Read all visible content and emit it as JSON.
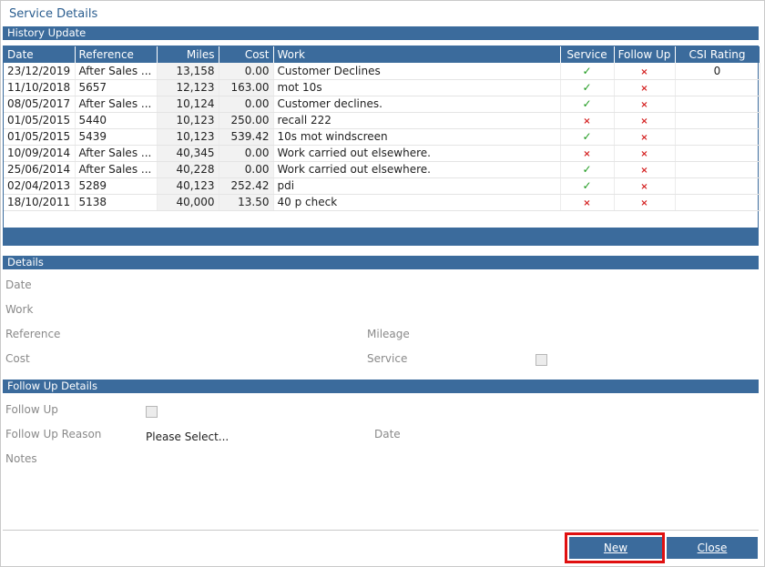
{
  "window": {
    "title": "Service Details"
  },
  "history": {
    "header": "History Update",
    "columns": {
      "date": "Date",
      "reference": "Reference",
      "miles": "Miles",
      "cost": "Cost",
      "work": "Work",
      "service": "Service",
      "follow_up": "Follow Up",
      "csi_rating": "CSI Rating"
    },
    "rows": [
      {
        "date": "23/12/2019",
        "reference": "After Sales ...",
        "miles": "13,158",
        "cost": "0.00",
        "work": "Customer Declines",
        "service": true,
        "follow_up": false,
        "csi": "0"
      },
      {
        "date": "11/10/2018",
        "reference": "5657",
        "miles": "12,123",
        "cost": "163.00",
        "work": "mot 10s",
        "service": true,
        "follow_up": false,
        "csi": ""
      },
      {
        "date": "08/05/2017",
        "reference": "After Sales ...",
        "miles": "10,124",
        "cost": "0.00",
        "work": "Customer declines.",
        "service": true,
        "follow_up": false,
        "csi": ""
      },
      {
        "date": "01/05/2015",
        "reference": "5440",
        "miles": "10,123",
        "cost": "250.00",
        "work": "recall 222",
        "service": false,
        "follow_up": false,
        "csi": ""
      },
      {
        "date": "01/05/2015",
        "reference": "5439",
        "miles": "10,123",
        "cost": "539.42",
        "work": "10s mot windscreen",
        "service": true,
        "follow_up": false,
        "csi": ""
      },
      {
        "date": "10/09/2014",
        "reference": "After Sales ...",
        "miles": "40,345",
        "cost": "0.00",
        "work": "Work carried out elsewhere.",
        "service": false,
        "follow_up": false,
        "csi": ""
      },
      {
        "date": "25/06/2014",
        "reference": "After Sales ...",
        "miles": "40,228",
        "cost": "0.00",
        "work": "Work carried out elsewhere.",
        "service": true,
        "follow_up": false,
        "csi": ""
      },
      {
        "date": "02/04/2013",
        "reference": "5289",
        "miles": "40,123",
        "cost": "252.42",
        "work": "pdi",
        "service": true,
        "follow_up": false,
        "csi": ""
      },
      {
        "date": "18/10/2011",
        "reference": "5138",
        "miles": "40,000",
        "cost": "13.50",
        "work": "40 p check",
        "service": false,
        "follow_up": false,
        "csi": ""
      }
    ]
  },
  "details": {
    "header": "Details",
    "date_label": "Date",
    "work_label": "Work",
    "reference_label": "Reference",
    "mileage_label": "Mileage",
    "cost_label": "Cost",
    "service_label": "Service"
  },
  "follow_up": {
    "header": "Follow Up Details",
    "follow_up_label": "Follow Up",
    "reason_label": "Follow Up Reason",
    "reason_value": "Please Select...",
    "date_label": "Date",
    "notes_label": "Notes"
  },
  "buttons": {
    "new_label": "New",
    "close_label": "Close"
  },
  "colors": {
    "accent": "#3b6b9c",
    "tick": "#1f9a1f",
    "cross": "#d42020",
    "highlight": "#e01010"
  },
  "icons": {
    "tick": "check-icon",
    "cross": "cross-icon"
  }
}
